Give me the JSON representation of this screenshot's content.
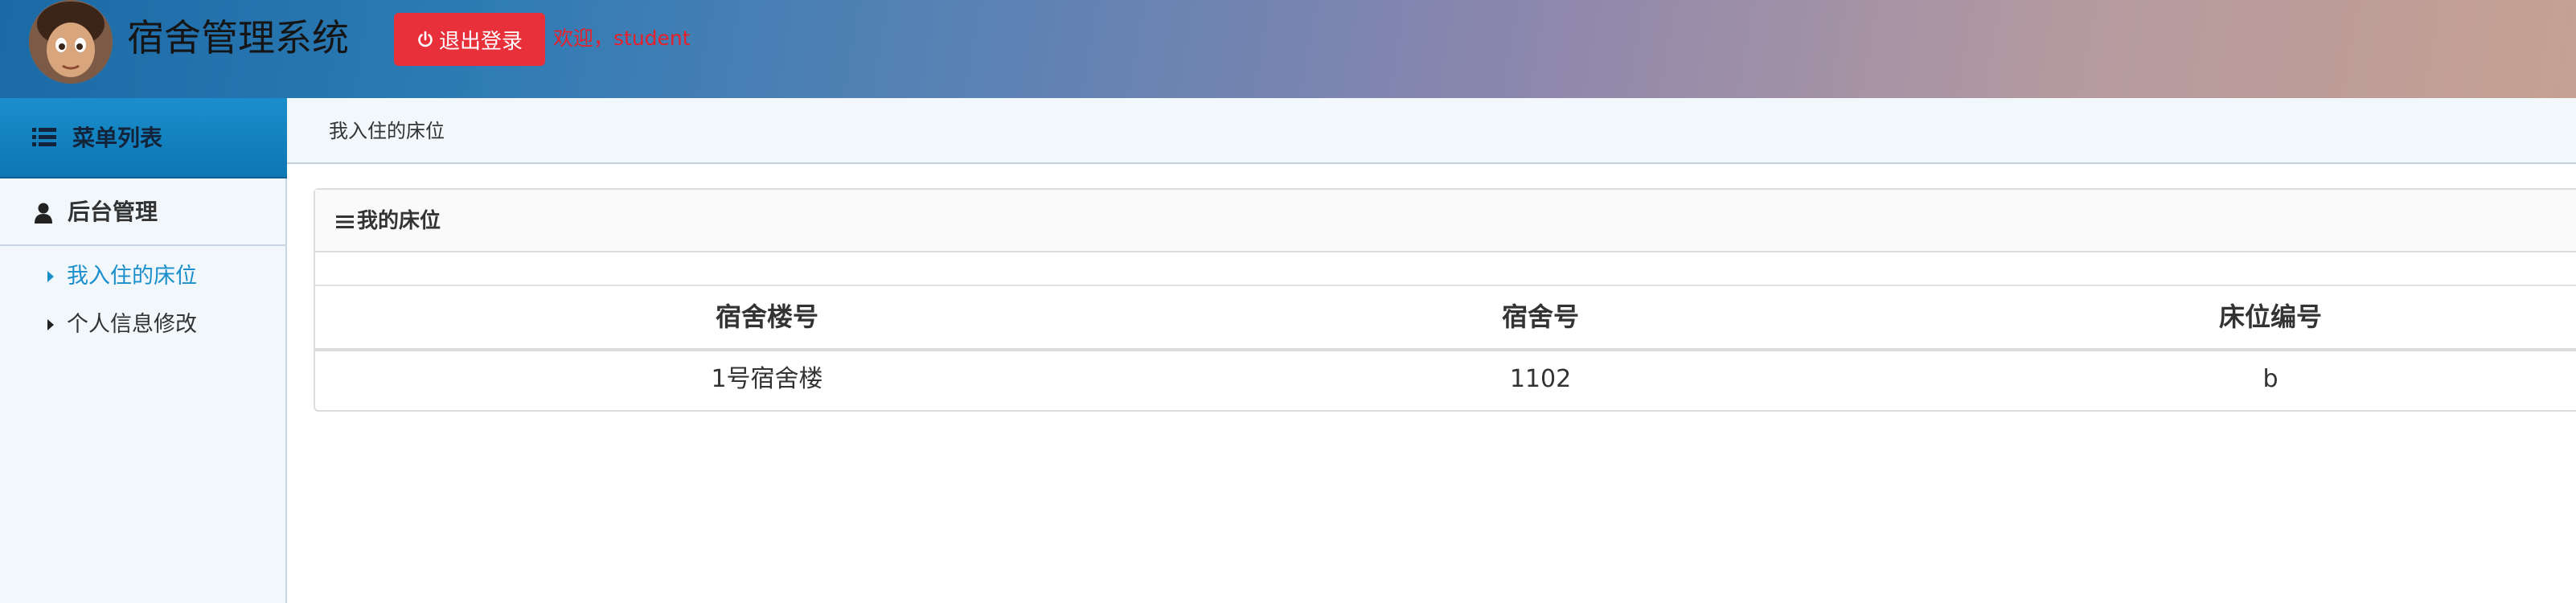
{
  "header": {
    "title": "宿舍管理系统",
    "logout_label": "退出登录",
    "welcome_text": "欢迎，student"
  },
  "sidebar": {
    "menu_title": "菜单列表",
    "section_label": "后台管理",
    "items": [
      {
        "label": "我入住的床位",
        "active": true
      },
      {
        "label": "个人信息修改",
        "active": false
      }
    ]
  },
  "breadcrumb": {
    "current": "我入住的床位"
  },
  "panel": {
    "title": "我的床位",
    "columns": [
      "宿舍楼号",
      "宿舍号",
      "床位编号"
    ],
    "rows": [
      [
        "1号宿舍楼",
        "1102",
        "b"
      ]
    ]
  },
  "colors": {
    "accent": "#1a8fcc",
    "logout": "#e7303a",
    "welcome": "#e8202a"
  }
}
